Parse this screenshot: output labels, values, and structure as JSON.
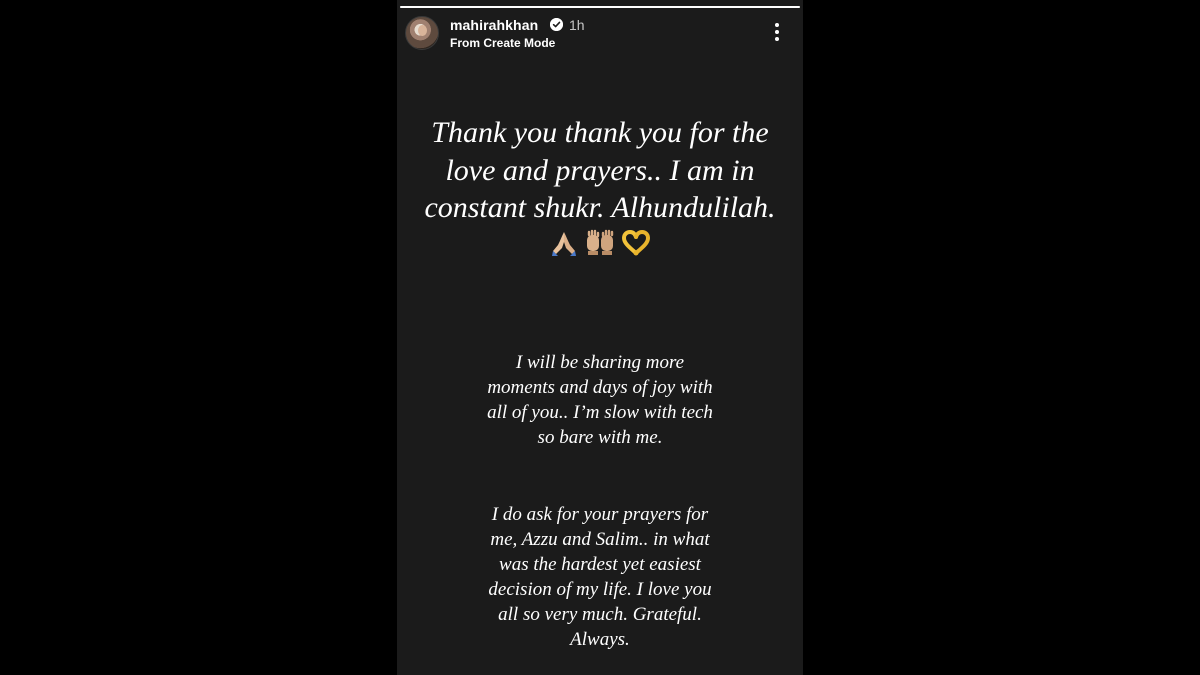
{
  "story": {
    "progress": 1.0,
    "username": "mahirahkhan",
    "verified": true,
    "time_ago": "1h",
    "subtitle": "From Create Mode",
    "menu_icon": "more-vertical-icon",
    "blocks": [
      {
        "lines": [
          "Thank you thank you for the",
          "love and prayers.. I am in",
          "constant shukr. Alhundulilah."
        ],
        "emojis": [
          "folded-hands-icon",
          "raised-hands-icon",
          "heart-hands-icon"
        ]
      },
      {
        "lines": [
          "I will be sharing more",
          "moments and days of joy with",
          "all of you.. I’m slow with tech",
          "so bare with me."
        ]
      },
      {
        "lines": [
          "I do ask for your prayers for",
          "me, Azzu and Salim.. in what",
          "was the hardest yet easiest",
          "decision of my life. I love you",
          "all so very much. Grateful.",
          "Always."
        ]
      }
    ]
  },
  "colors": {
    "page_background": "#000000",
    "story_background": "#1b1b1b",
    "text": "#ffffff",
    "emoji_skin": "#e3b58e"
  }
}
